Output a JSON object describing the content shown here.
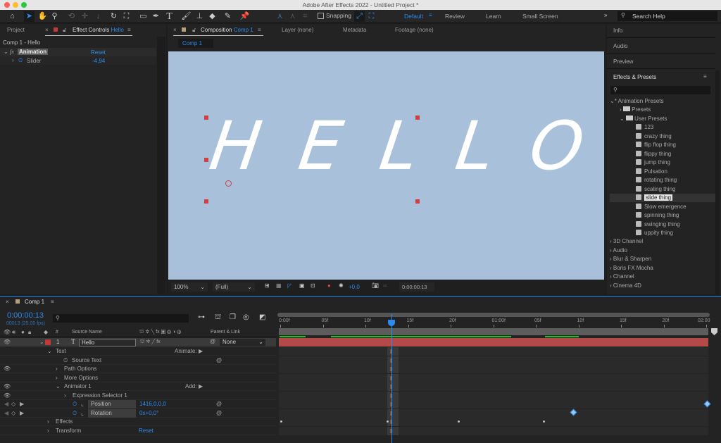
{
  "window": {
    "title": "Adobe After Effects 2022 - Untitled Project *"
  },
  "toolbar": {
    "snapping": "Snapping",
    "workspaces": [
      "Default",
      "Review",
      "Learn",
      "Small Screen"
    ],
    "search_placeholder": "Search Help",
    "more": "»"
  },
  "left_panel": {
    "tabs": [
      "Project",
      "Effect Controls"
    ],
    "layer_name": "Hello",
    "breadcrumb": "Comp 1 - Hello",
    "effect": {
      "name": "Animation",
      "reset": "Reset",
      "property": "Slider",
      "value": "-4,94"
    }
  },
  "comp_panel": {
    "tab_label": "Composition",
    "comp_name": "Comp 1",
    "other_tabs": [
      "Layer (none)",
      "Metadata",
      "Footage (none)"
    ],
    "sub_tab": "Comp 1",
    "text": "HELLO",
    "zoom": "100%",
    "resolution": "(Full)",
    "exposure": "+0,0",
    "timecode": "0:00:00:13",
    "bg_color": "#a9c0da"
  },
  "right_panel": {
    "sections": [
      "Info",
      "Audio",
      "Preview"
    ],
    "effects_title": "Effects & Presets",
    "tree": {
      "root": "* Animation Presets",
      "presets": "Presets",
      "user_presets": "User Presets",
      "items": [
        "123",
        "crazy thing",
        "flip flop thing",
        "flippy thing",
        "jump thing",
        "Pulsation",
        "rotating thing",
        "scaling thing",
        "slide thing",
        "Slow emergence",
        "spinning thing",
        "swinging thing",
        "uppity thing"
      ],
      "selected": "slide thing",
      "categories": [
        "3D Channel",
        "Audio",
        "Blur & Sharpen",
        "Boris FX Mocha",
        "Channel",
        "Cinema 4D"
      ]
    }
  },
  "timeline": {
    "comp_name": "Comp 1",
    "timecode": "0:00:00:13",
    "frame_info": "00013 (25.00 fps)",
    "headers": {
      "num": "#",
      "source_name": "Source Name",
      "parent": "Parent & Link"
    },
    "layer": {
      "num": "1",
      "name": "Hello",
      "parent": "None"
    },
    "rows": {
      "text": "Text",
      "animate": "Animate:",
      "source_text": "Source Text",
      "path_options": "Path Options",
      "more_options": "More Options",
      "animator": "Animator 1",
      "add": "Add:",
      "expr_selector": "Expression Selector 1",
      "position": "Position",
      "position_value": "1416,0,0,0",
      "rotation": "Rotation",
      "rotation_value": "0x+0,0°",
      "effects": "Effects",
      "transform": "Transform",
      "reset": "Reset"
    },
    "ruler": [
      "0:00f",
      "05f",
      "10f",
      "15f",
      "20f",
      "01:00f",
      "05f",
      "10f",
      "15f",
      "20f",
      "02:00"
    ],
    "current_frame": 13,
    "layer_color": "#b34a4a"
  }
}
